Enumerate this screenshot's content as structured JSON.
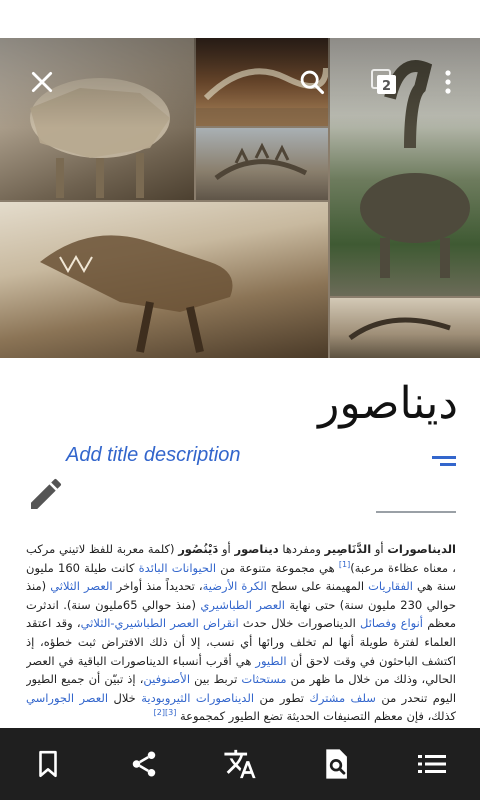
{
  "article": {
    "title": "ديناصور",
    "description_placeholder": "Add title description",
    "paragraph": [
      {
        "text": "الديناصورات",
        "style": "bold"
      },
      {
        "text": " أو ",
        "style": "plain"
      },
      {
        "text": "الدَّنَاصِير",
        "style": "bold"
      },
      {
        "text": " ومفردها ",
        "style": "plain"
      },
      {
        "text": "ديناصور",
        "style": "bold"
      },
      {
        "text": " أو ",
        "style": "plain"
      },
      {
        "text": "دَيْنُصُور",
        "style": "bold"
      },
      {
        "text": " (كلمة معربة للفظ لاتيني مركب ، معناه عظاءة مرعبة)",
        "style": "plain"
      },
      {
        "text": "[1]",
        "style": "ref"
      },
      {
        "text": " هي مجموعة متنوعة من ",
        "style": "plain"
      },
      {
        "text": "الحيوانات البائدة",
        "style": "link"
      },
      {
        "text": " كانت طيلة 160 مليون سنة هي ",
        "style": "plain"
      },
      {
        "text": "الفقاريات",
        "style": "link"
      },
      {
        "text": " المهيمنة على سطح ",
        "style": "plain"
      },
      {
        "text": "الكرة الأرضية",
        "style": "link"
      },
      {
        "text": "، تحديداً منذ أواخر ",
        "style": "plain"
      },
      {
        "text": "العصر الثلاثي",
        "style": "link"
      },
      {
        "text": " (منذ حوالي 230 مليون سنة) حتى نهاية ",
        "style": "plain"
      },
      {
        "text": "العصر الطباشيري",
        "style": "link"
      },
      {
        "text": " (منذ حوالي 65مليون سنة). اندثرت معظم ",
        "style": "plain"
      },
      {
        "text": "أنواع وفصائل",
        "style": "link"
      },
      {
        "text": " الديناصورات خلال حدث ",
        "style": "plain"
      },
      {
        "text": "انقراض العصر الطباشيري-الثلاثي",
        "style": "link"
      },
      {
        "text": "، وقد اعتقد العلماء لفترة طويلة أنها لم تخلف ورائها أي نسب، إلا أن ذلك الافتراض ثبت خطؤه، إذ اكتشف الباحثون في وقت لاحق أن ",
        "style": "plain"
      },
      {
        "text": "الطيور",
        "style": "link"
      },
      {
        "text": " هي أقرب أنسباء الديناصورات الباقية في العصر الحالي، وذلك من خلال ما ظهر من ",
        "style": "plain"
      },
      {
        "text": "مستحثات",
        "style": "link"
      },
      {
        "text": " تربط بين ",
        "style": "plain"
      },
      {
        "text": "الأصنوفين",
        "style": "link"
      },
      {
        "text": "، إذ تبيّن أن جميع الطيور اليوم تنحدر من ",
        "style": "plain"
      },
      {
        "text": "سلف مشترك",
        "style": "link"
      },
      {
        "text": " تطور من ",
        "style": "plain"
      },
      {
        "text": "الديناصورات",
        "style": "link"
      },
      {
        "text": " ",
        "style": "plain"
      },
      {
        "text": "الثيروبودية",
        "style": "link"
      },
      {
        "text": " خلال ",
        "style": "plain"
      },
      {
        "text": "العصر الجوراسي",
        "style": "link"
      },
      {
        "text": " كذلك، فإن معظم التصنيفات الحديثة تضع الطيور كمجموعة ",
        "style": "plain"
      },
      {
        "text": "[3][2]",
        "style": "ref"
      }
    ]
  },
  "toolbar": {
    "items": [
      {
        "name": "bookmark-button",
        "icon": "bookmark-icon"
      },
      {
        "name": "share-button",
        "icon": "share-icon"
      },
      {
        "name": "translate-button",
        "icon": "translate-icon"
      },
      {
        "name": "find-in-page-button",
        "icon": "find-in-page-icon"
      },
      {
        "name": "contents-button",
        "icon": "list-icon"
      }
    ]
  },
  "header": {
    "tabs_count": "2"
  },
  "colors": {
    "link": "#3366cc",
    "toolbar_bg": "#1f1f1f",
    "text": "#222222"
  }
}
